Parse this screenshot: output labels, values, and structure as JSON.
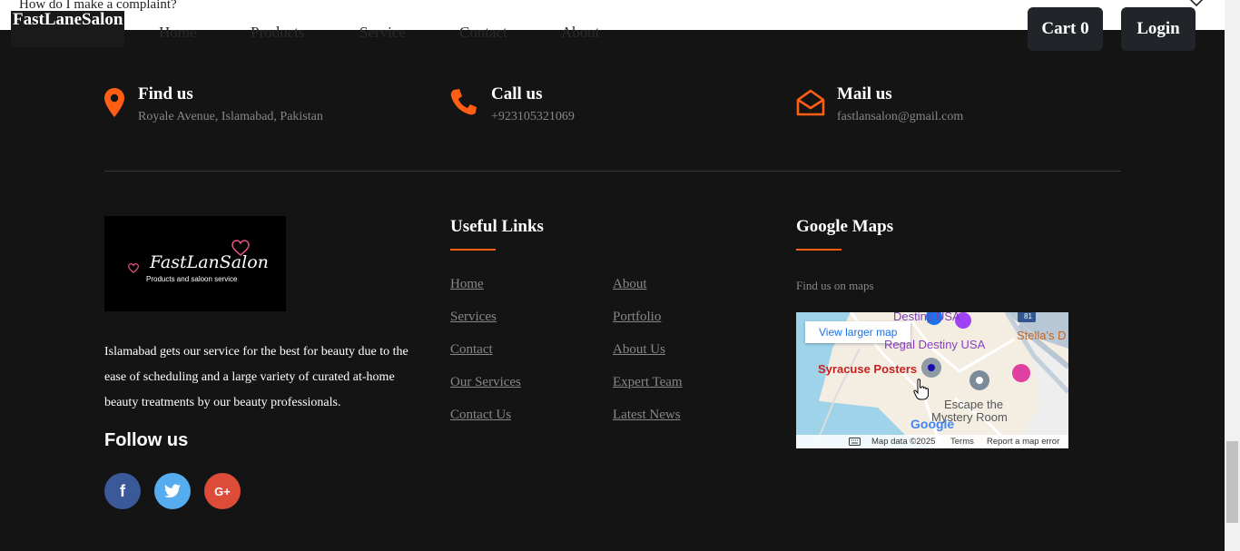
{
  "faq": {
    "question": "How do I make a complaint?"
  },
  "header": {
    "brand": "FastLaneSalon",
    "nav": [
      "Home",
      "Products",
      "Service",
      "Contact",
      "About"
    ],
    "cart_label": "Cart 0",
    "login_label": "Login"
  },
  "contacts": [
    {
      "title": "Find us",
      "value": "Royale Avenue, Islamabad, Pakistan",
      "icon": "map-marker-icon"
    },
    {
      "title": "Call us",
      "value": "+923105321069",
      "icon": "phone-icon"
    },
    {
      "title": "Mail us",
      "value": "fastlansalon@gmail.com",
      "icon": "envelope-open-icon"
    }
  ],
  "footer_logo": {
    "title": "FastLanSalon",
    "subtitle": "Products and saloon service"
  },
  "about_text": "Islamabad gets our service for the best for beauty due to the ease of scheduling and a large variety of curated at-home beauty treatments by our beauty professionals.",
  "follow_us": "Follow us",
  "social": [
    {
      "name": "facebook",
      "glyph": "f",
      "color": "#3b5998"
    },
    {
      "name": "twitter",
      "glyph": "t",
      "color": "#55acee"
    },
    {
      "name": "google-plus",
      "glyph": "G+",
      "color": "#dd4b39"
    }
  ],
  "useful_links": {
    "title": "Useful Links",
    "left": [
      "Home",
      "Services",
      "Contact",
      "Our Services",
      "Contact Us"
    ],
    "right": [
      "About",
      "Portfolio",
      "About Us",
      "Expert Team",
      "Latest News"
    ]
  },
  "maps": {
    "title": "Google Maps",
    "subtitle": "Find us on maps",
    "view_larger": "View larger map",
    "labels": {
      "destiny": "Destiny USA",
      "regal": "Regal Destiny USA",
      "stellas": "Stella's D",
      "syracuse": "Syracuse Posters",
      "escape1": "Escape the",
      "escape2": "Mystery Room",
      "google": "Google",
      "highway": "81"
    },
    "footer": {
      "data": "Map data ©2025",
      "terms": "Terms",
      "report": "Report a map error"
    }
  },
  "colors": {
    "accent": "#ff5e14",
    "background": "#151414",
    "muted": "#878787"
  }
}
